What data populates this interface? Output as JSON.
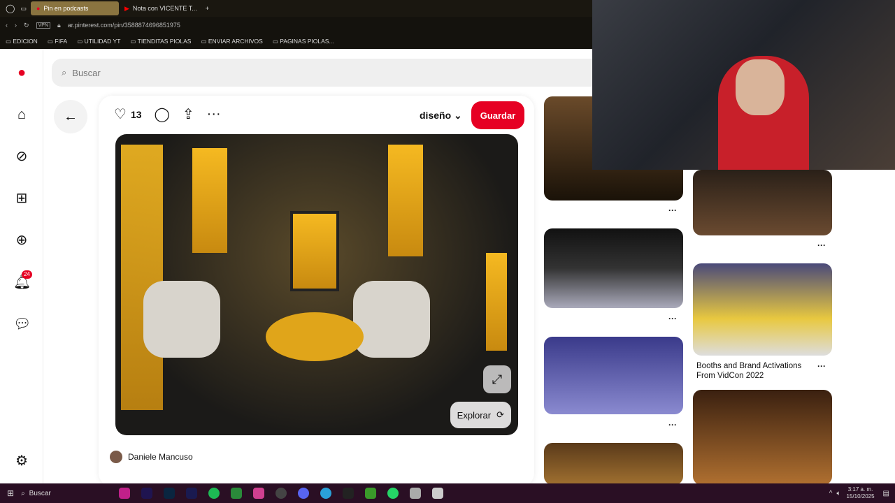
{
  "browser": {
    "tabs": [
      {
        "label": "Pin en podcasts"
      },
      {
        "label": "Nota con VICENTE T..."
      }
    ],
    "url": "ar.pinterest.com/pin/3588874696851975",
    "vpn": "VPN",
    "bookmarks": [
      "EDICION",
      "FIFA",
      "UTILIDAD YT",
      "TIENDITAS PIOLAS",
      "ENVIAR ARCHIVOS",
      "PAGINAS PIOLAS..."
    ]
  },
  "search": {
    "placeholder": "Buscar"
  },
  "sidebar": {
    "notification_count": "24"
  },
  "pin": {
    "likes": "13",
    "board": "diseño",
    "save_label": "Guardar",
    "explore_label": "Explorar",
    "author": "Daniele Mancuso"
  },
  "related": [
    {
      "title": "Booths and Brand Activations From VidCon 2022"
    }
  ],
  "taskbar": {
    "search": "Buscar",
    "time": "3:17 a. m.",
    "date": "15/10/2025"
  },
  "colors": {
    "accent": "#e60023"
  }
}
